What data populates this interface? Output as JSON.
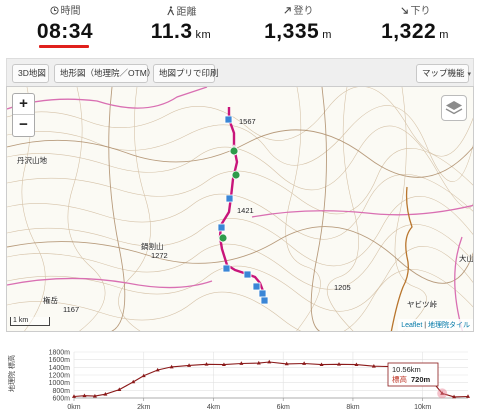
{
  "stats": [
    {
      "label": "時間",
      "value": "08:34",
      "unit": ""
    },
    {
      "label": "距離",
      "value": "11.3",
      "unit": "km"
    },
    {
      "label": "登り",
      "value": "1,335",
      "unit": "m"
    },
    {
      "label": "下り",
      "value": "1,322",
      "unit": "m"
    }
  ],
  "colors": {
    "accent": "#e0201c",
    "route": "#c8157a",
    "profile": "#8b1a1a"
  },
  "toolbar": {
    "btn_3d": "3D地図",
    "btn_otm": "地形図（地理院／OTM）",
    "btn_print": "地図プリで印刷",
    "btn_menu": "マップ機能"
  },
  "map": {
    "zoom_in": "+",
    "zoom_out": "−",
    "scale": "1 km",
    "attr_leaflet": "Leaflet",
    "attr_sep": " | ",
    "attr_gsi": "地理院タイル",
    "labels": {
      "l1": "1567",
      "l2": "1421",
      "l3": "1272",
      "l4": "1167",
      "l5": "1205",
      "l6": "ヤビツ峠",
      "l7": "大山",
      "l8": "権岳",
      "l9": "鍋割山",
      "l10": "丹沢山地"
    }
  },
  "elevation": {
    "y_title": "地理院 標高",
    "y_ticks": [
      "1800m",
      "1600m",
      "1400m",
      "1200m",
      "1000m",
      "800m",
      "600m"
    ],
    "x_ticks": [
      "0km",
      "2km",
      "4km",
      "6km",
      "8km",
      "10km"
    ],
    "tooltip": {
      "distance": "10.56km",
      "label": "標高",
      "value": "720m"
    }
  },
  "chart_data": {
    "type": "line",
    "title": "",
    "xlabel": "",
    "ylabel": "地理院 標高",
    "xlim": [
      0,
      11.3
    ],
    "ylim": [
      600,
      1800
    ],
    "x": [
      0,
      0.3,
      0.6,
      0.9,
      1.3,
      1.7,
      2.0,
      2.4,
      2.8,
      3.3,
      3.8,
      4.3,
      4.8,
      5.3,
      5.6,
      6.1,
      6.6,
      7.1,
      7.6,
      8.1,
      8.6,
      9.1,
      9.6,
      10.1,
      10.56,
      10.9,
      11.3
    ],
    "series": [
      {
        "values": [
          640,
          660,
          650,
          700,
          820,
          1020,
          1180,
          1330,
          1410,
          1450,
          1480,
          1470,
          1500,
          1510,
          1540,
          1490,
          1500,
          1470,
          1480,
          1470,
          1430,
          1420,
          1390,
          1220,
          720,
          630,
          640
        ]
      }
    ],
    "grid": true
  }
}
